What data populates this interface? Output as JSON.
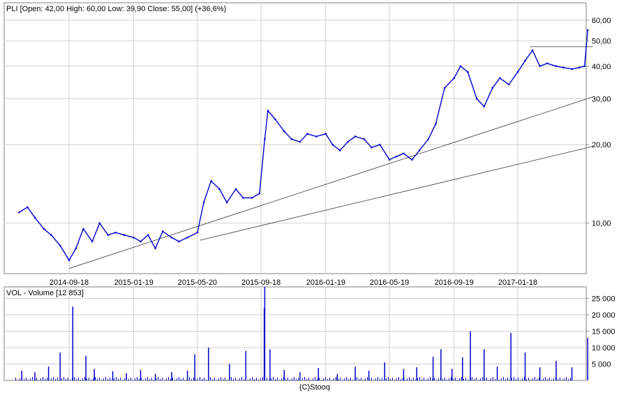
{
  "chart_data": [
    {
      "type": "line",
      "title": "PLI [Open: 42,00  High: 60,00  Low: 39,90  Close: 55,00] (+36,6%)",
      "scale": "log",
      "grid": true,
      "color": "#0000cc",
      "xlabel": "",
      "ylabel": "",
      "x_ticks": [
        "2014-09-18",
        "2015-01-19",
        "2015-05-20",
        "2015-09-18",
        "2016-01-19",
        "2016-05-19",
        "2016-09-19",
        "2017-01-18"
      ],
      "y_ticks": [
        "10,00",
        "20,00",
        "30,00",
        "40,00",
        "50,00",
        "60,00"
      ],
      "ylim": [
        6.4,
        70
      ],
      "x": [
        "2014-06-15",
        "2014-07-01",
        "2014-07-15",
        "2014-08-01",
        "2014-08-15",
        "2014-09-01",
        "2014-09-18",
        "2014-10-01",
        "2014-10-15",
        "2014-11-01",
        "2014-11-15",
        "2014-12-01",
        "2014-12-15",
        "2015-01-01",
        "2015-01-19",
        "2015-02-01",
        "2015-02-15",
        "2015-03-01",
        "2015-03-15",
        "2015-04-01",
        "2015-04-15",
        "2015-05-01",
        "2015-05-20",
        "2015-06-01",
        "2015-06-15",
        "2015-07-01",
        "2015-07-15",
        "2015-08-01",
        "2015-08-15",
        "2015-09-01",
        "2015-09-15",
        "2015-09-25",
        "2015-10-01",
        "2015-10-15",
        "2015-11-01",
        "2015-11-15",
        "2015-12-01",
        "2015-12-15",
        "2016-01-01",
        "2016-01-19",
        "2016-02-01",
        "2016-02-15",
        "2016-03-01",
        "2016-03-15",
        "2016-04-01",
        "2016-04-15",
        "2016-05-01",
        "2016-05-19",
        "2016-06-01",
        "2016-06-15",
        "2016-07-01",
        "2016-07-15",
        "2016-08-01",
        "2016-08-15",
        "2016-09-01",
        "2016-09-19",
        "2016-10-01",
        "2016-10-15",
        "2016-11-01",
        "2016-11-15",
        "2016-12-01",
        "2016-12-15",
        "2017-01-01",
        "2017-01-18",
        "2017-02-01",
        "2017-02-15",
        "2017-03-01",
        "2017-03-15",
        "2017-04-01",
        "2017-04-15",
        "2017-05-01",
        "2017-05-15",
        "2017-05-25",
        "2017-05-31"
      ],
      "values": [
        11.0,
        11.5,
        10.5,
        9.5,
        9.0,
        8.2,
        7.2,
        8.0,
        9.5,
        8.5,
        10.0,
        9.0,
        9.2,
        9.0,
        8.8,
        8.5,
        9.0,
        8.0,
        9.3,
        8.8,
        8.5,
        8.8,
        9.2,
        12.0,
        14.5,
        13.5,
        12.0,
        13.5,
        12.5,
        12.5,
        13.0,
        21.0,
        27.0,
        25.0,
        22.5,
        21.0,
        20.5,
        22.0,
        21.5,
        22.0,
        20.0,
        19.0,
        20.5,
        21.5,
        21.0,
        19.5,
        20.0,
        17.5,
        18.0,
        18.5,
        17.5,
        19.0,
        21.0,
        24.0,
        33.0,
        36.0,
        40.0,
        38.0,
        30.0,
        28.0,
        33.0,
        36.0,
        34.0,
        38.0,
        42.0,
        46.0,
        40.0,
        41.0,
        40.0,
        39.5,
        39.0,
        39.5,
        40.0,
        55.0
      ],
      "lines": [
        {
          "from": [
            "2014-09-18",
            6.7
          ],
          "to": [
            "2017-06-10",
            30.5
          ]
        },
        {
          "from": [
            "2015-05-25",
            8.6
          ],
          "to": [
            "2017-06-10",
            19.7
          ]
        },
        {
          "from": [
            "2017-02-10",
            47.5
          ],
          "to": [
            "2017-06-10",
            47.5
          ]
        }
      ]
    },
    {
      "type": "bar",
      "title": "VOL - Volume [12 853]",
      "color": "#0000cc",
      "y_ticks": [
        "5 000",
        "10 000",
        "15 000",
        "20 000",
        "25 000"
      ],
      "ylim": [
        0,
        28500
      ],
      "x": [
        "2014-06-20",
        "2014-07-15",
        "2014-08-10",
        "2014-09-01",
        "2014-09-25",
        "2014-10-20",
        "2014-11-05",
        "2014-12-10",
        "2015-01-05",
        "2015-02-01",
        "2015-03-01",
        "2015-04-01",
        "2015-05-01",
        "2015-05-15",
        "2015-06-10",
        "2015-07-20",
        "2015-08-20",
        "2015-09-24",
        "2015-09-25",
        "2015-10-05",
        "2015-11-01",
        "2015-12-01",
        "2016-01-05",
        "2016-02-10",
        "2016-03-15",
        "2016-04-10",
        "2016-05-10",
        "2016-06-15",
        "2016-07-10",
        "2016-08-10",
        "2016-08-25",
        "2016-09-15",
        "2016-10-05",
        "2016-10-20",
        "2016-11-15",
        "2016-12-10",
        "2017-01-05",
        "2017-02-01",
        "2017-03-01",
        "2017-04-01",
        "2017-05-01",
        "2017-05-31"
      ],
      "values": [
        3000,
        2500,
        4200,
        8500,
        22500,
        7500,
        3500,
        2800,
        2200,
        3200,
        2000,
        2500,
        3000,
        8000,
        10000,
        5000,
        9000,
        22000,
        28500,
        9500,
        3200,
        2500,
        3800,
        2000,
        4200,
        3000,
        5500,
        3500,
        4000,
        7200,
        9500,
        3500,
        7000,
        15000,
        9500,
        4200,
        14500,
        8500,
        4000,
        6000,
        4000,
        13000
      ]
    }
  ],
  "footer": "(C)Stooq"
}
